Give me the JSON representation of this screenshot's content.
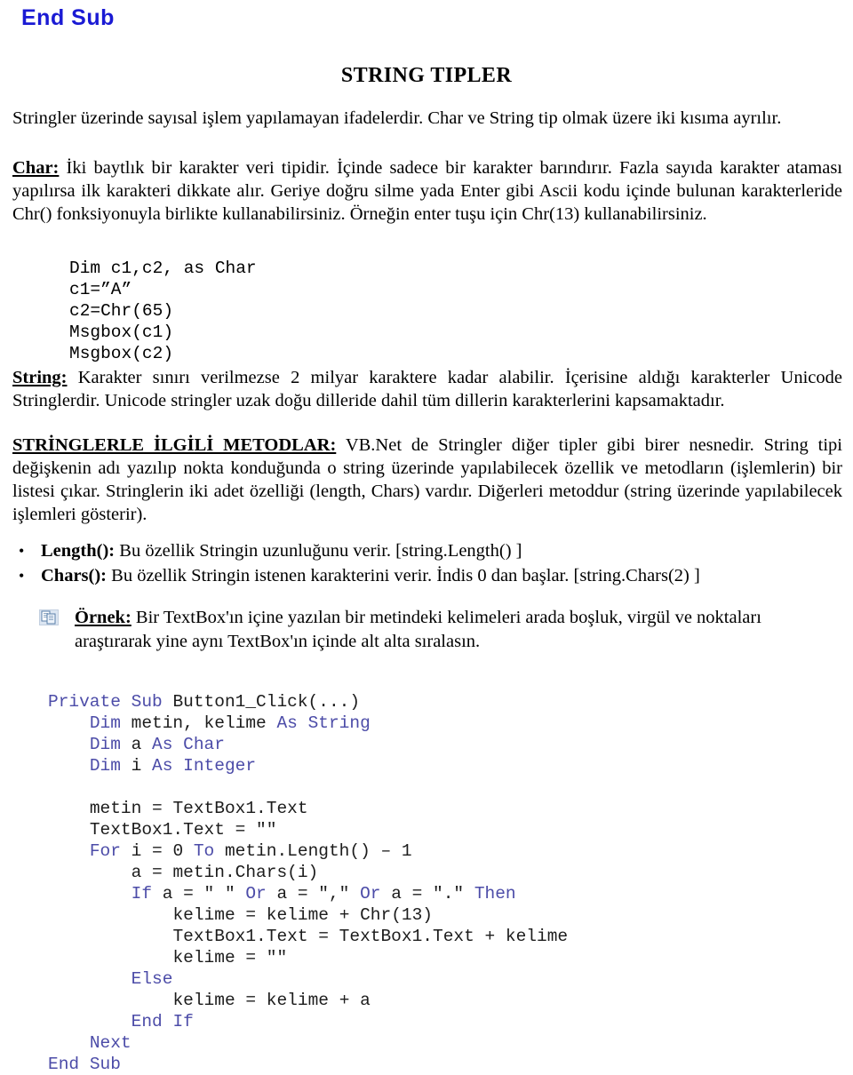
{
  "document": {
    "top_fragment": "End Sub",
    "title": "STRING TIPLER",
    "accent_blue": "#1a1ad4",
    "code_blue": "#2b2b8c",
    "intro": {
      "text": "Stringler üzerinde sayısal işlem yapılamayan ifadelerdir. Char ve String tip olmak üzere iki kısıma ayrılır."
    },
    "char_section": {
      "lead": "Char:",
      "body": " İki baytlık bir karakter veri tipidir. İçinde sadece bir karakter barındırır. Fazla sayıda karakter ataması yapılırsa ilk karakteri dikkate alır.  Geriye doğru silme yada Enter gibi Ascii kodu içinde bulunan karakterleride Chr() fonksiyonuyla birlikte kullanabilirsiniz. Örneğin enter tuşu için Chr(13) kullanabilirsiniz.",
      "code": "Dim c1,c2, as Char\nc1=”A”\nc2=Chr(65)\nMsgbox(c1)\nMsgbox(c2)"
    },
    "string_section": {
      "lead": "String:",
      "body": " Karakter sınırı verilmezse 2 milyar karaktere kadar alabilir. İçerisine aldığı karakterler Unicode Stringlerdir. Unicode stringler uzak doğu dilleride dahil tüm dillerin karakterlerini kapsamaktadır."
    },
    "methods_section": {
      "lead": "STRİNGLERLE İLGİLİ METODLAR:",
      "body": " VB.Net de Stringler diğer tipler gibi birer nesnedir. String tipi değişkenin adı yazılıp  nokta konduğunda o string üzerinde yapılabilecek özellik ve metodların (işlemlerin) bir listesi çıkar. Stringlerin iki adet özelliği (length, Chars) vardır. Diğerleri metoddur (string üzerinde yapılabilecek işlemleri gösterir)."
    },
    "bullets": [
      {
        "marker": "•",
        "lead": "Length():",
        "body": " Bu özellik Stringin uzunluğunu verir. [string.Length() ]"
      },
      {
        "marker": "•",
        "lead": "Chars():",
        "body": " Bu özellik Stringin istenen karakterini verir. İndis 0 dan başlar. [string.Chars(2) ]"
      }
    ],
    "example": {
      "icon_name": "copy-pages-icon",
      "lead": "Örnek:",
      "body": " Bir TextBox'ın içine yazılan bir metindeki kelimeleri arada boşluk, virgül ve noktaları araştırarak yine aynı TextBox'ın içinde alt alta sıralasın."
    },
    "main_code": {
      "lines": [
        "Private Sub Button1_Click(...)",
        "    Dim metin, kelime As String",
        "    Dim a As Char",
        "    Dim i As Integer",
        "",
        "    metin = TextBox1.Text",
        "    TextBox1.Text = \"\"",
        "    For i = 0 To metin.Length() – 1",
        "        a = metin.Chars(i)",
        "        If a = \" \" Or a = \",\" Or a = \".\" Then",
        "            kelime = kelime + Chr(13)",
        "            TextBox1.Text = TextBox1.Text + kelime",
        "            kelime = \"\"",
        "        Else",
        "            kelime = kelime + a",
        "        End If",
        "    Next",
        "End Sub"
      ],
      "text": "Private Sub Button1_Click(...)\n    Dim metin, kelime As String\n    Dim a As Char\n    Dim i As Integer\n\n    metin = TextBox1.Text\n    TextBox1.Text = \"\"\n    For i = 0 To metin.Length() – 1\n        a = metin.Chars(i)\n        If a = \" \" Or a = \",\" Or a = \".\" Then\n            kelime = kelime + Chr(13)\n            TextBox1.Text = TextBox1.Text + kelime\n            kelime = \"\"\n        Else\n            kelime = kelime + a\n        End If\n    Next\nEnd Sub"
    }
  }
}
